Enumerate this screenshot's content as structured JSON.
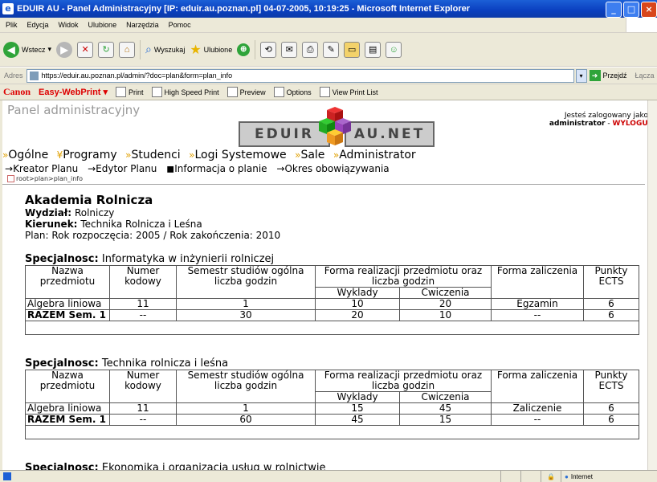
{
  "window": {
    "title": "EDUIR AU - Panel Administracyjny [IP: eduir.au.poznan.pl] 04-07-2005, 10:19:25 - Microsoft Internet Explorer"
  },
  "menu": [
    "Plik",
    "Edycja",
    "Widok",
    "Ulubione",
    "Narzędzia",
    "Pomoc"
  ],
  "toolbar": {
    "back": "Wstecz",
    "search": "Wyszukaj",
    "favorites": "Ulubione"
  },
  "address": {
    "label": "Adres",
    "url": "https://eduir.au.poznan.pl/admin/?doc=plan&form=plan_info",
    "go": "Przejdź",
    "links": "Łącza"
  },
  "canon": {
    "brand": "Canon",
    "product": "Easy-WebPrint",
    "print": "Print",
    "hsprint": "High Speed Print",
    "preview": "Preview",
    "options": "Options",
    "viewlist": "View Print List"
  },
  "page": {
    "panel_title": "Panel administracyjny",
    "logged_as": "Jesteś zalogowany jako:",
    "user": "administrator",
    "logout": "WYLOGUJ",
    "logo_left": "EDUIR",
    "logo_right": "AU.NET",
    "nav": [
      "Ogólne",
      "Programy",
      "Studenci",
      "Logi Systemowe",
      "Sale",
      "Administrator"
    ],
    "subnav": [
      "Kreator Planu",
      "Edytor Planu",
      "Informacja o planie",
      "Okres obowiązywania"
    ],
    "breadcrumb": "root>plan>plan_info",
    "university": "Akademia Rolnicza",
    "faculty_label": "Wydział:",
    "faculty": "Rolniczy",
    "course_label": "Kierunek:",
    "course": "Technika Rolnicza i Leśna",
    "plan_line": "Plan: Rok rozpoczęcia: 2005 / Rok zakończenia: 2010"
  },
  "table_headers": {
    "name": "Nazwa przedmiotu",
    "code": "Numer kodowy",
    "semester": "Semestr studiów ogólna liczba godzin",
    "form": "Forma realizacji przedmiotu oraz liczba godzin",
    "lectures": "Wyklady",
    "exercises": "Cwiczenia",
    "credit": "Forma zaliczenia",
    "ects": "Punkty ECTS"
  },
  "specializations": [
    {
      "label": "Specjalnosc:",
      "name": "Informatyka w inżynierii rolniczej",
      "rows": [
        {
          "name": "Algebra liniowa",
          "code": "11",
          "semester": "1",
          "lectures": "10",
          "exercises": "20",
          "credit": "Egzamin",
          "ects": "6"
        },
        {
          "name": "RAZEM Sem. 1",
          "code": "--",
          "semester": "30",
          "lectures": "20",
          "exercises": "10",
          "credit": "--",
          "ects": "6"
        }
      ]
    },
    {
      "label": "Specjalnosc:",
      "name": "Technika rolnicza i leśna",
      "rows": [
        {
          "name": "Algebra liniowa",
          "code": "11",
          "semester": "1",
          "lectures": "15",
          "exercises": "45",
          "credit": "Zaliczenie",
          "ects": "6"
        },
        {
          "name": "RAZEM Sem. 1",
          "code": "--",
          "semester": "60",
          "lectures": "45",
          "exercises": "15",
          "credit": "--",
          "ects": "6"
        }
      ]
    },
    {
      "label": "Specjalnosc:",
      "name": "Ekonomika i organizacja usług w rolnictwie"
    }
  ],
  "status": {
    "zone": "Internet"
  }
}
